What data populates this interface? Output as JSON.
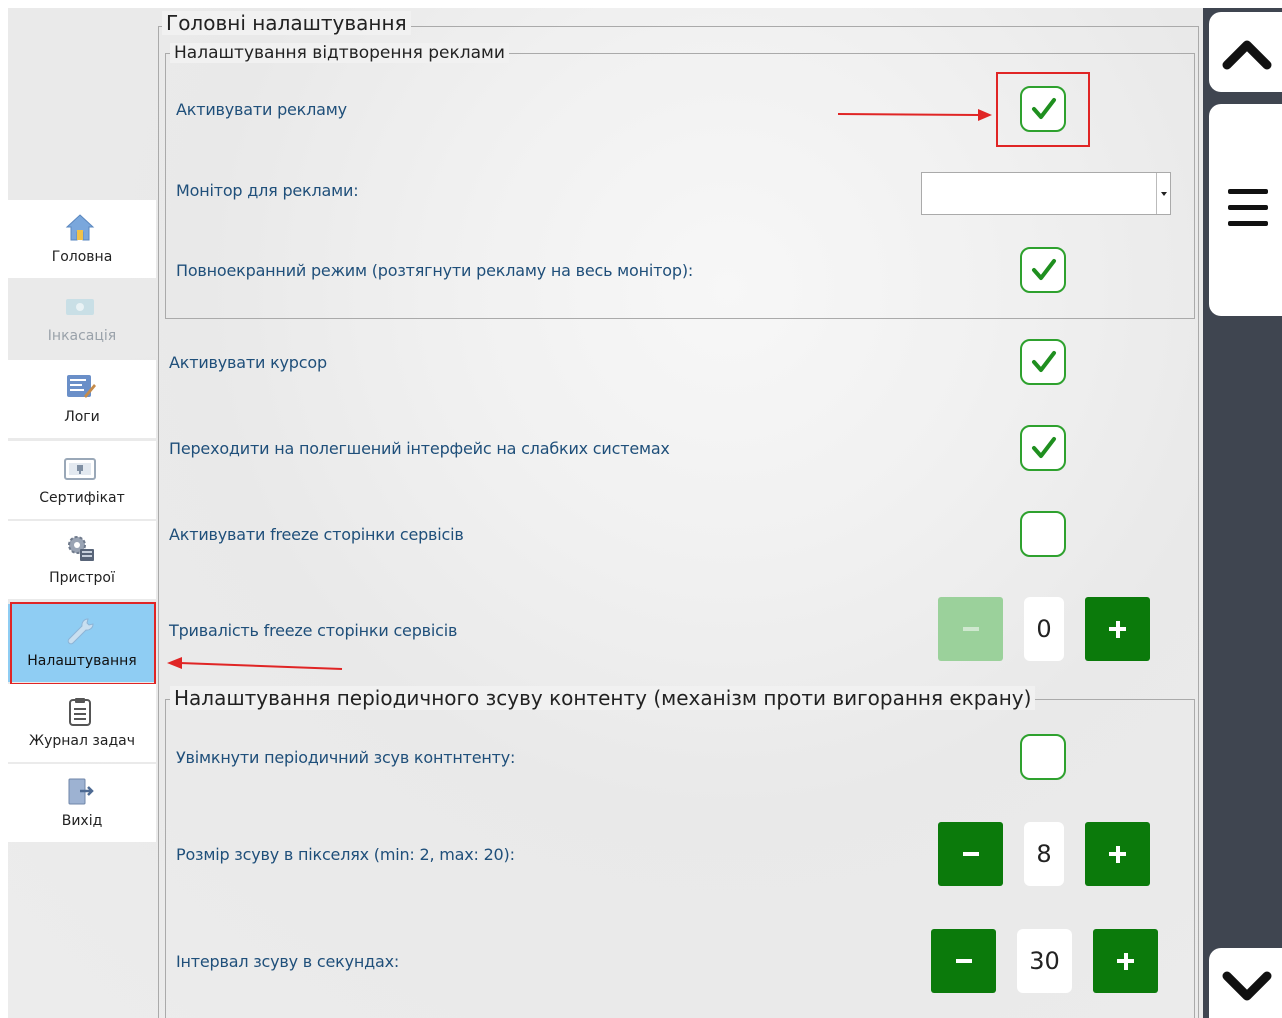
{
  "sidebar": {
    "items": [
      {
        "label": "Головна",
        "state": "normal"
      },
      {
        "label": "Інкасація",
        "state": "disabled"
      },
      {
        "label": "Логи",
        "state": "normal"
      },
      {
        "label": "Сертифікат",
        "state": "normal"
      },
      {
        "label": "Пристрої",
        "state": "normal"
      },
      {
        "label": "Налаштування",
        "state": "active"
      },
      {
        "label": "Журнал задач",
        "state": "normal"
      },
      {
        "label": "Вихід",
        "state": "normal"
      }
    ]
  },
  "main": {
    "title": "Головні налаштування",
    "ad_group": {
      "title": "Налаштування відтворення реклами",
      "activate_ads_label": "Активувати рекламу",
      "activate_ads_checked": true,
      "monitor_label": "Монітор для реклами:",
      "monitor_value": "",
      "fullscreen_label": "Повноекранний режим (розтягнути рекламу на весь монітор):",
      "fullscreen_checked": true
    },
    "cursor_label": "Активувати курсор",
    "cursor_checked": true,
    "light_ui_label": "Переходити на полегшений інтерфейс на слабких системах",
    "light_ui_checked": true,
    "freeze_label": "Активувати freeze сторінки сервісів",
    "freeze_checked": false,
    "freeze_duration_label": "Тривалість freeze сторінки сервісів",
    "freeze_duration_value": "0",
    "shift_group": {
      "title": "Налаштування періодичного зсуву контенту (механізм проти вигорання екрану)",
      "enable_label": "Увімкнути періодичний зсув контнтенту:",
      "enable_checked": false,
      "size_label": "Розмір зсуву в пікселях (min: 2, max: 20):",
      "size_value": "8",
      "interval_label": "Інтервал зсуву в секундах:",
      "interval_value": "30"
    }
  },
  "colors": {
    "accent_green": "#0b7a0b",
    "checkbox_border": "#2ea12e",
    "active_nav": "#8fcdf3",
    "annotation_red": "#e02525",
    "label_blue": "#1f4f7a",
    "scroll_strip": "#3f4550"
  },
  "icons": {
    "scroll_up": "chevron-up-icon",
    "menu": "hamburger-menu-icon",
    "scroll_down": "chevron-down-icon"
  }
}
